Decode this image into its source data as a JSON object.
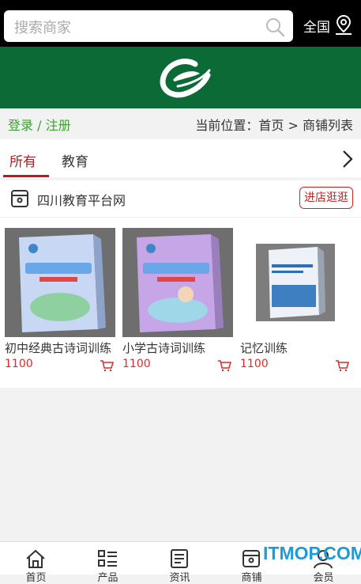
{
  "search": {
    "placeholder": "搜索商家"
  },
  "region": {
    "label": "全国"
  },
  "breadcrumb": {
    "login": "登录 / 注册",
    "location": "当前位置：首页 > 商铺列表"
  },
  "tabs": [
    {
      "label": "所有",
      "active": true
    },
    {
      "label": "教育",
      "active": false
    }
  ],
  "shop": {
    "name": "四川教育平台网",
    "visit_label": "进店逛逛",
    "products": [
      {
        "name": "初中经典古诗词训练",
        "price": "1100"
      },
      {
        "name": "小学古诗词训练",
        "price": "1100"
      },
      {
        "name": "记忆训练",
        "price": "1100"
      }
    ]
  },
  "bottom_nav": [
    {
      "label": "首页",
      "icon": "home-icon"
    },
    {
      "label": "产品",
      "icon": "list-icon"
    },
    {
      "label": "资讯",
      "icon": "news-icon"
    },
    {
      "label": "商铺",
      "icon": "shop-icon"
    },
    {
      "label": "会员",
      "icon": "user-icon"
    }
  ],
  "watermark": "ITMOP.COM",
  "colors": {
    "brand_green": "#0b6a35",
    "accent_red": "#b31e1e",
    "price_red": "#d62b2b",
    "link_green": "#3aa32d"
  }
}
